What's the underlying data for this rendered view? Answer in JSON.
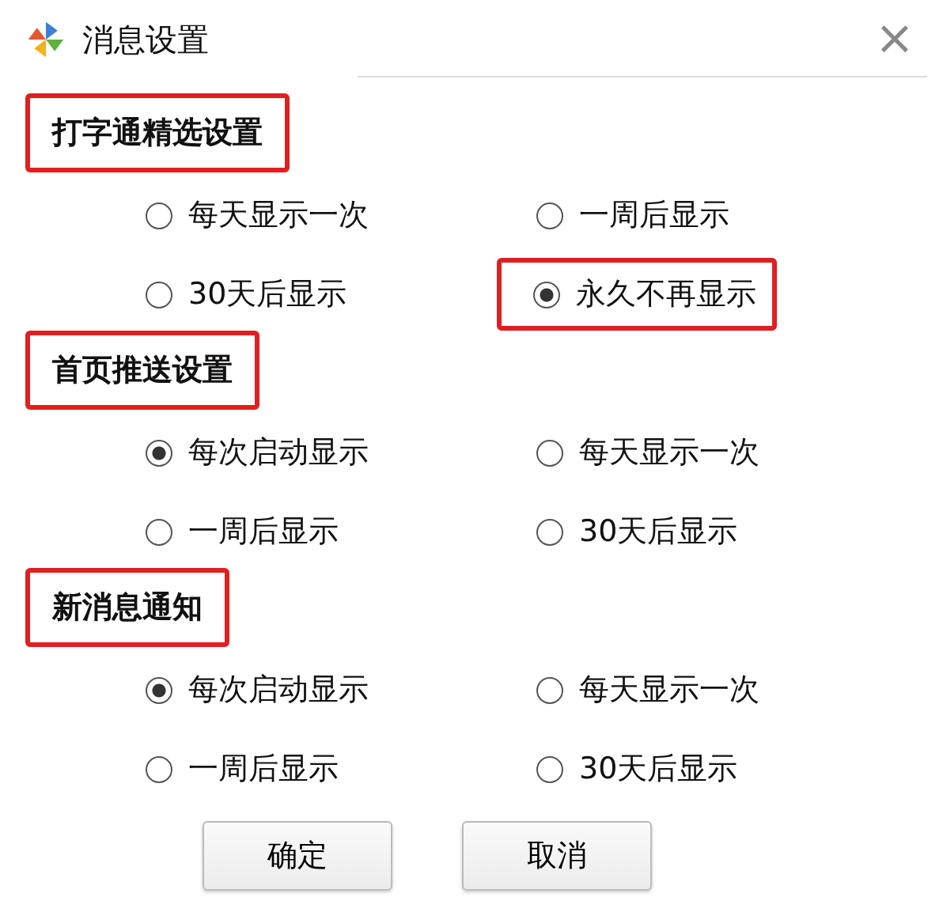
{
  "window": {
    "title": "消息设置",
    "close": "×"
  },
  "sections": [
    {
      "title": "打字通精选设置",
      "highlighted": true,
      "options": [
        {
          "label": "每天显示一次",
          "selected": false,
          "highlighted": false
        },
        {
          "label": "一周后显示",
          "selected": false,
          "highlighted": false
        },
        {
          "label": "30天后显示",
          "selected": false,
          "highlighted": false
        },
        {
          "label": "永久不再显示",
          "selected": true,
          "highlighted": true
        }
      ]
    },
    {
      "title": "首页推送设置",
      "highlighted": true,
      "options": [
        {
          "label": "每次启动显示",
          "selected": true,
          "highlighted": false
        },
        {
          "label": "每天显示一次",
          "selected": false,
          "highlighted": false
        },
        {
          "label": "一周后显示",
          "selected": false,
          "highlighted": false
        },
        {
          "label": "30天后显示",
          "selected": false,
          "highlighted": false
        }
      ]
    },
    {
      "title": "新消息通知",
      "highlighted": true,
      "options": [
        {
          "label": "每次启动显示",
          "selected": true,
          "highlighted": false
        },
        {
          "label": "每天显示一次",
          "selected": false,
          "highlighted": false
        },
        {
          "label": "一周后显示",
          "selected": false,
          "highlighted": false
        },
        {
          "label": "30天后显示",
          "selected": false,
          "highlighted": false
        }
      ]
    }
  ],
  "buttons": [
    "确定",
    "取消"
  ]
}
